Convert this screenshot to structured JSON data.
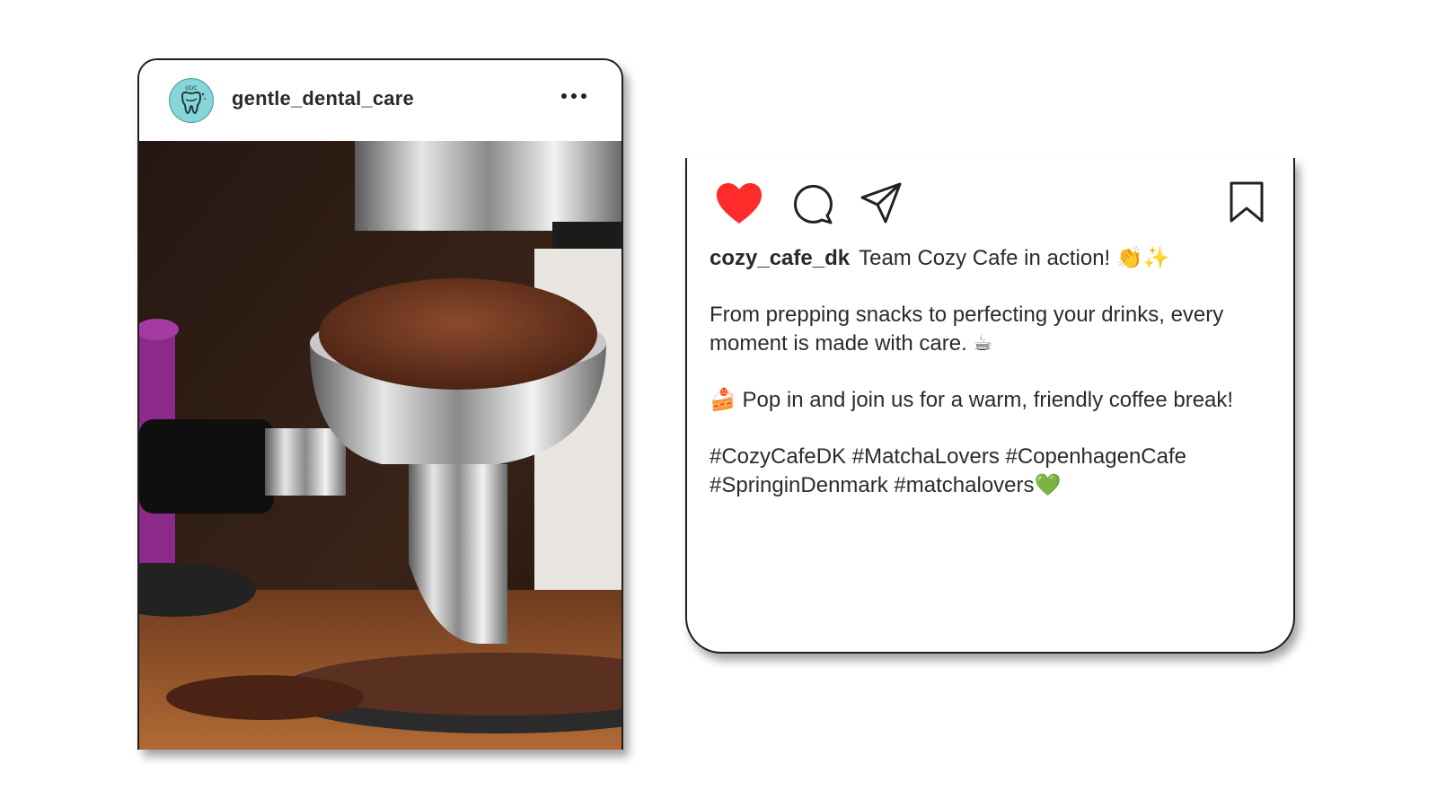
{
  "post": {
    "account": {
      "username": "gentle_dental_care",
      "avatar_text": "GDC"
    },
    "more_icon": "more-horizontal-icon",
    "photo_alt": "Espresso portafilter with ground coffee"
  },
  "caption_card": {
    "icons": {
      "like": "heart-icon",
      "comment": "comment-icon",
      "share": "share-icon",
      "save": "bookmark-icon"
    },
    "colors": {
      "heart": "#ff2a2a"
    },
    "username": "cozy_cafe_dk",
    "line1": "Team Cozy Cafe in action! 👏✨",
    "line2": "From prepping snacks to perfecting your drinks, every moment is made with care. ☕",
    "line3": "🍰 Pop in and join us for a warm, friendly coffee break!",
    "line4": "#CozyCafeDK #MatchaLovers #CopenhagenCafe #SpringinDenmark #matchalovers💚"
  }
}
